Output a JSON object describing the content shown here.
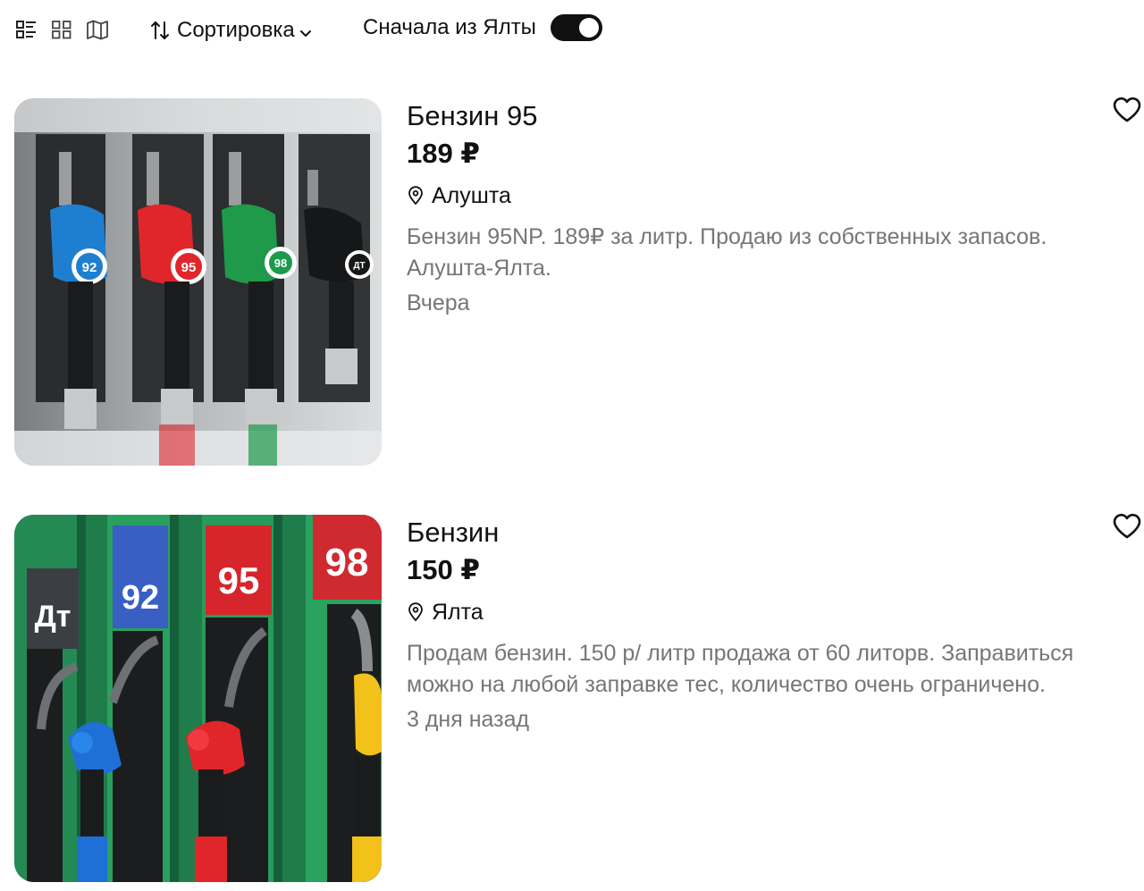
{
  "toolbar": {
    "icons": [
      "list-view-icon",
      "grid-view-icon",
      "map-view-icon"
    ],
    "sort_label": "Сортировка",
    "yalta_first_label": "Сначала из Ялты",
    "yalta_first_enabled": true
  },
  "listings": [
    {
      "title": "Бензин 95",
      "price": "189 ₽",
      "location": "Алушта",
      "description": "Бензин 95NP. 189₽ за литр. Продаю из собственных запасов. Алушта-Ялта.",
      "date": "Вчера",
      "photo_labels": [
        "92",
        "95",
        "98",
        "ДТ"
      ]
    },
    {
      "title": "Бензин",
      "price": "150 ₽",
      "location": "Ялта",
      "description": "Продам бензин. 150 р/ литр продажа от 60 литорв. Заправиться можно на любой заправке тес, количество очень ограничено.",
      "date": "3 дня назад",
      "photo_labels": [
        "Дт",
        "92",
        "95",
        "98"
      ]
    }
  ],
  "colors": {
    "text": "#111111",
    "muted": "#767676",
    "toggle_on": "#111111",
    "nozzle_blue": "#1e7fd0",
    "nozzle_red": "#e0262b",
    "nozzle_green": "#1e9a4a",
    "nozzle_yellow": "#f2c21a"
  }
}
